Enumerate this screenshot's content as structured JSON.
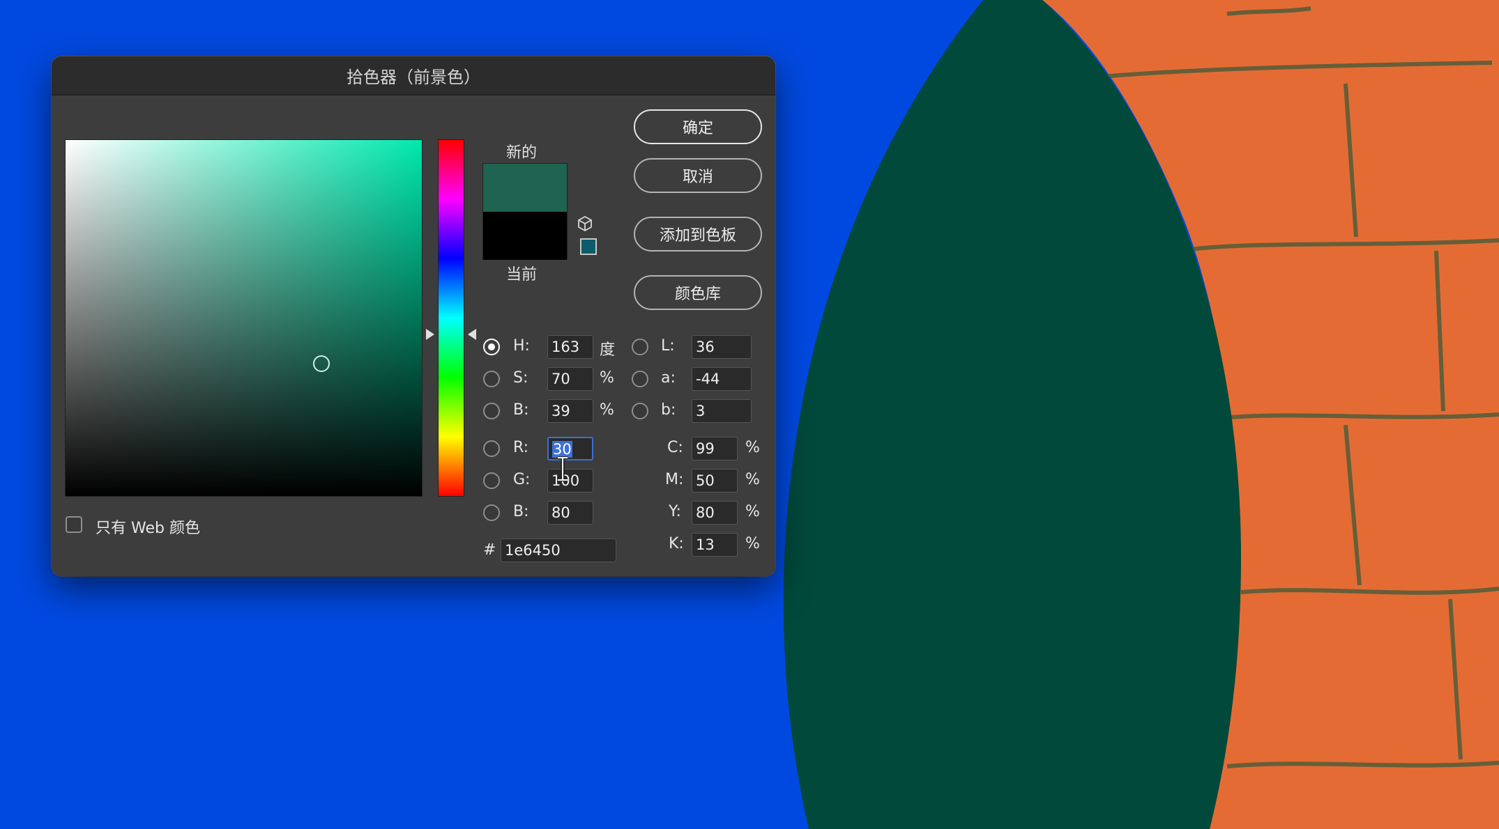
{
  "dialog": {
    "title": "拾色器（前景色）",
    "new_label": "新的",
    "current_label": "当前",
    "web_only_label": "只有 Web 颜色",
    "hex_prefix": "#",
    "hex_value": "1e6450",
    "new_color": "#1e6450",
    "current_color": "#000000",
    "buttons": {
      "ok": "确定",
      "cancel": "取消",
      "add_to_swatches": "添加到色板",
      "color_libraries": "颜色库"
    },
    "hsb": {
      "h_label": "H:",
      "h_value": "163",
      "h_unit": "度",
      "s_label": "S:",
      "s_value": "70",
      "s_unit": "%",
      "b_label": "B:",
      "b_value": "39",
      "b_unit": "%"
    },
    "lab": {
      "l_label": "L:",
      "l_value": "36",
      "a_label": "a:",
      "a_value": "-44",
      "b_label": "b:",
      "b_value": "3"
    },
    "rgb": {
      "r_label": "R:",
      "r_value": "30",
      "g_label": "G:",
      "g_value": "100",
      "b_label": "B:",
      "b_value": "80"
    },
    "cmyk": {
      "c_label": "C:",
      "c_value": "99",
      "c_unit": "%",
      "m_label": "M:",
      "m_value": "50",
      "m_unit": "%",
      "y_label": "Y:",
      "y_value": "80",
      "y_unit": "%",
      "k_label": "K:",
      "k_value": "13",
      "k_unit": "%"
    }
  },
  "colors": {
    "background_blue": "#0049e0",
    "leaf_green": "#01493b",
    "brick_orange": "#e46c34",
    "accent_selection": "#3e70d8"
  }
}
